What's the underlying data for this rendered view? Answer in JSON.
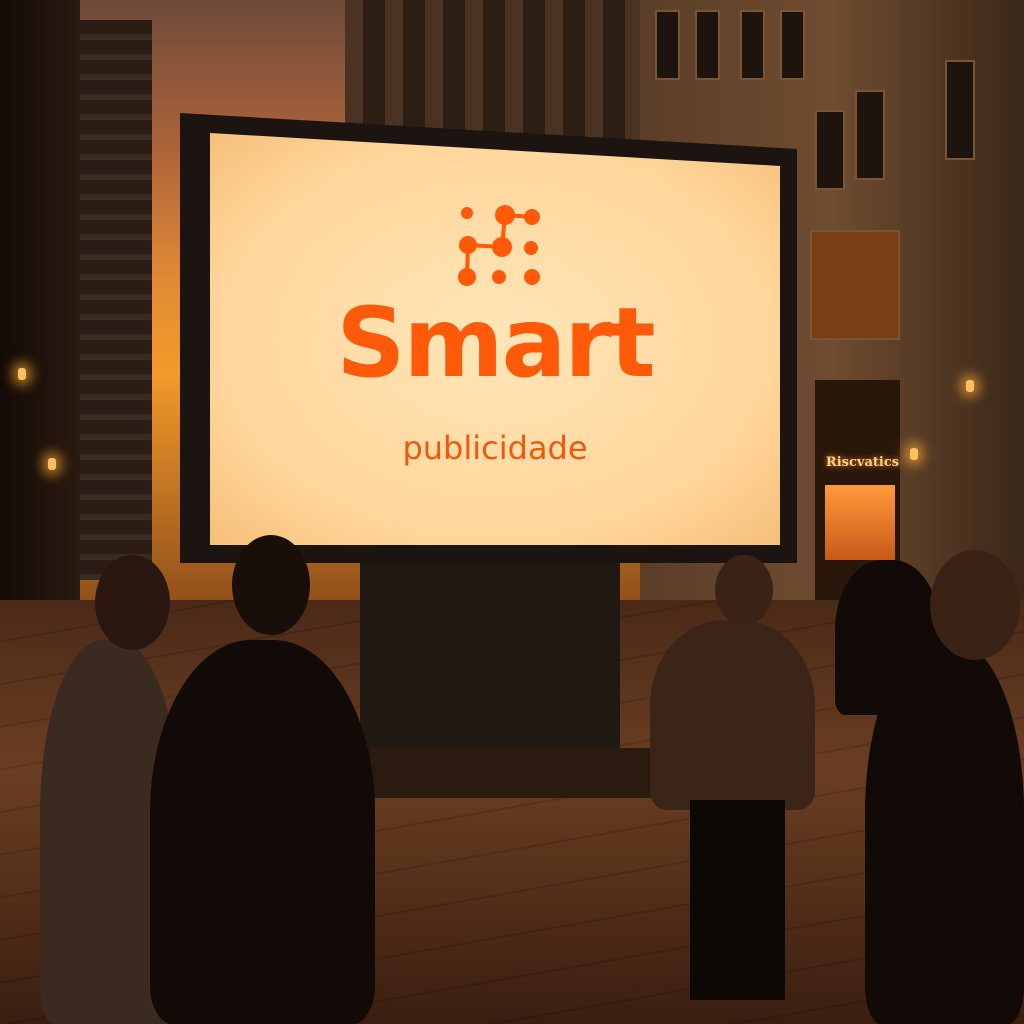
{
  "billboard": {
    "brand_name": "Smart",
    "tagline": "publicidade",
    "logo_icon": "connected-dots-icon",
    "brand_color": "#ff5a0a"
  },
  "storefront": {
    "sign": "Riscvatics"
  }
}
